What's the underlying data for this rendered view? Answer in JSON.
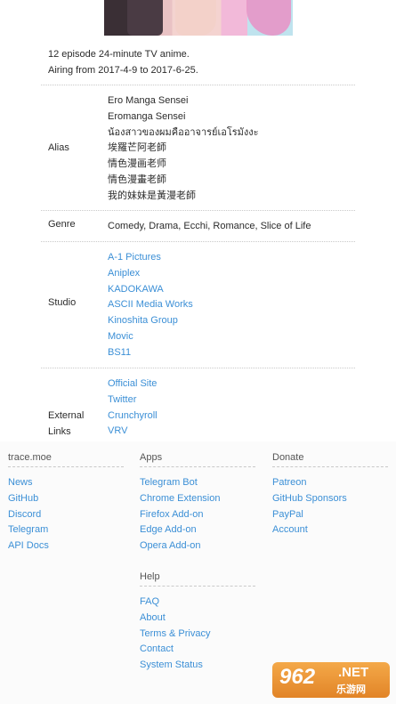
{
  "description": {
    "line1": "12 episode 24-minute TV anime.",
    "line2": "Airing from 2017-4-9 to 2017-6-25."
  },
  "alias": {
    "label": "Alias",
    "values": [
      "Ero Manga Sensei",
      "Eromanga Sensei",
      "น้องสาวของผมคืออาจารย์เอโรมังงะ",
      "埃羅芒阿老師",
      "情色漫画老师",
      "情色漫畫老師",
      "我的妹妹是黃漫老師"
    ]
  },
  "genre": {
    "label": "Genre",
    "value": "Comedy, Drama, Ecchi, Romance, Slice of Life"
  },
  "studio": {
    "label": "Studio",
    "values": [
      "A-1 Pictures",
      "Aniplex",
      "KADOKAWA",
      "ASCII Media Works",
      "Kinoshita Group",
      "Movic",
      "BS11"
    ]
  },
  "external": {
    "label_line1": "External",
    "label_line2": "Links",
    "values": [
      "Official Site",
      "Twitter",
      "Crunchyroll",
      "VRV"
    ]
  },
  "footer": {
    "site": {
      "title": "trace.moe",
      "links": [
        "News",
        "GitHub",
        "Discord",
        "Telegram",
        "API Docs"
      ]
    },
    "apps": {
      "title": "Apps",
      "links": [
        "Telegram Bot",
        "Chrome Extension",
        "Firefox Add-on",
        "Edge Add-on",
        "Opera Add-on"
      ]
    },
    "donate": {
      "title": "Donate",
      "links": [
        "Patreon",
        "GitHub Sponsors",
        "PayPal",
        "Account"
      ]
    },
    "help": {
      "title": "Help",
      "links": [
        "FAQ",
        "About",
        "Terms & Privacy",
        "Contact",
        "System Status"
      ]
    }
  },
  "watermark": {
    "number": "962",
    "domain": ".NET",
    "text": "乐游网"
  },
  "colors": {
    "link": "#3b8fd6",
    "text": "#2b2b2b",
    "divider": "#c9c9c9"
  }
}
